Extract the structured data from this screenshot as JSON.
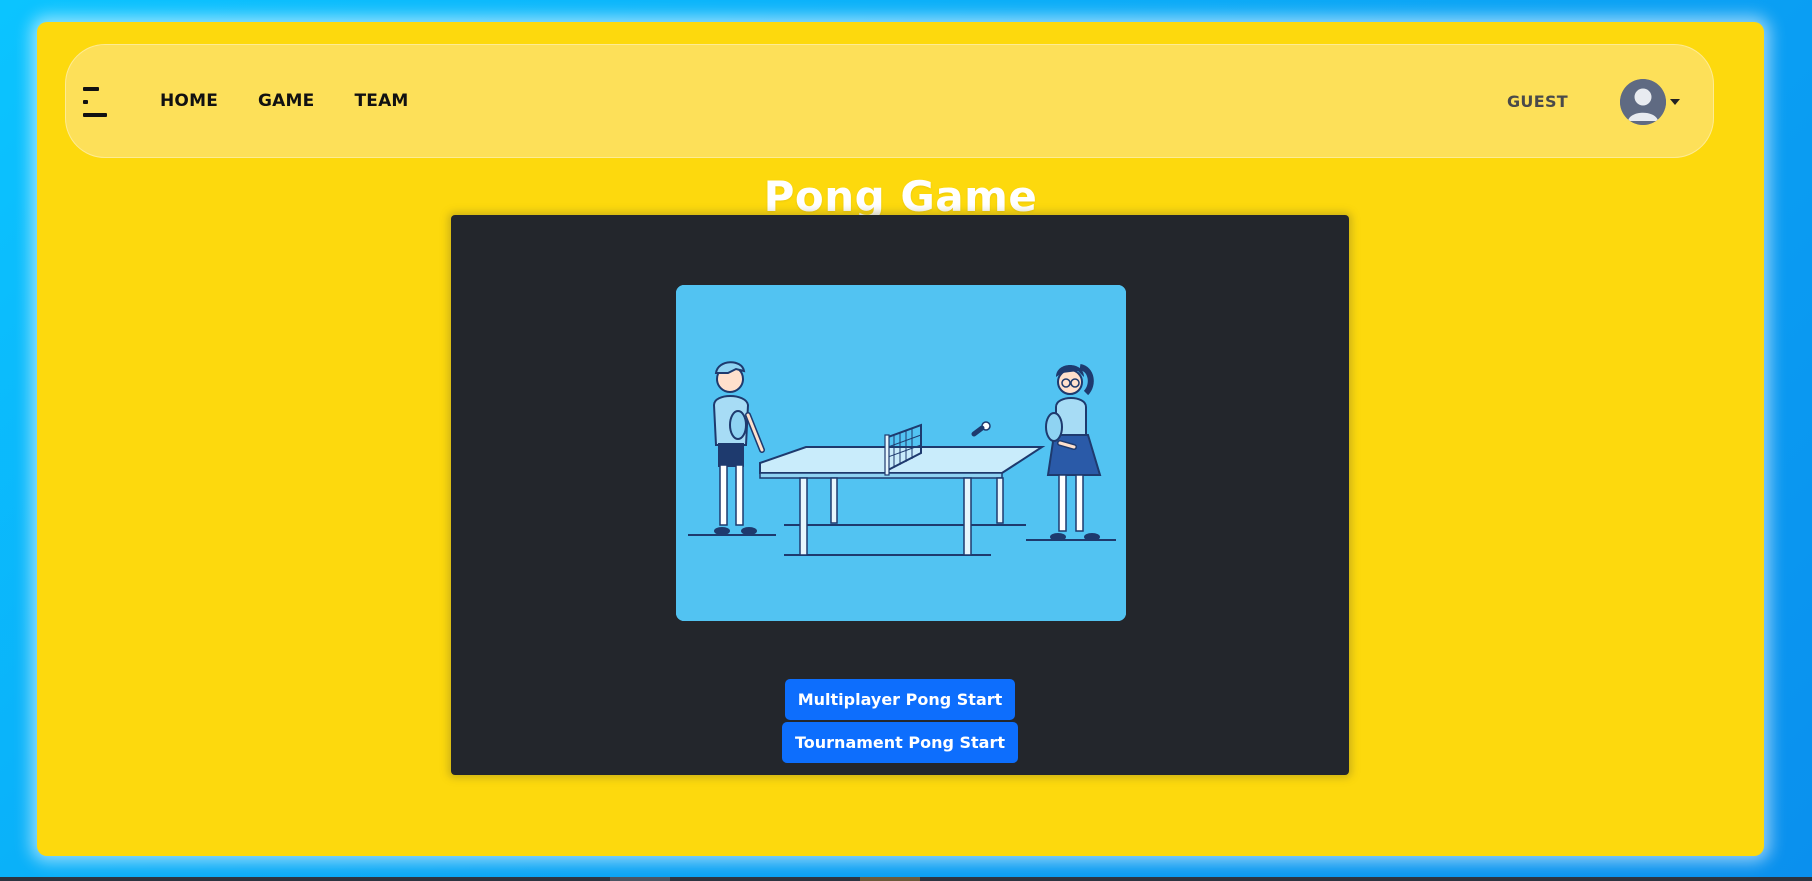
{
  "nav": {
    "links": [
      {
        "label": "HOME"
      },
      {
        "label": "GAME"
      },
      {
        "label": "TEAM"
      }
    ],
    "user_label": "GUEST"
  },
  "main": {
    "title": "Pong Game",
    "illustration": "ping-pong-players-illustration",
    "buttons": {
      "multiplayer": "Multiplayer Pong Start",
      "tournament": "Tournament Pong Start"
    }
  },
  "colors": {
    "page_background": "#fdd90d",
    "navbar_background": "#fde059",
    "panel_background": "#23262c",
    "illustration_background": "#52c3f2",
    "button_primary": "#0d6efd",
    "outer_background": "#0aa4f5"
  },
  "icons": {
    "menu": "menu-icon",
    "avatar": "user-avatar-icon",
    "dropdown": "chevron-down-icon"
  }
}
